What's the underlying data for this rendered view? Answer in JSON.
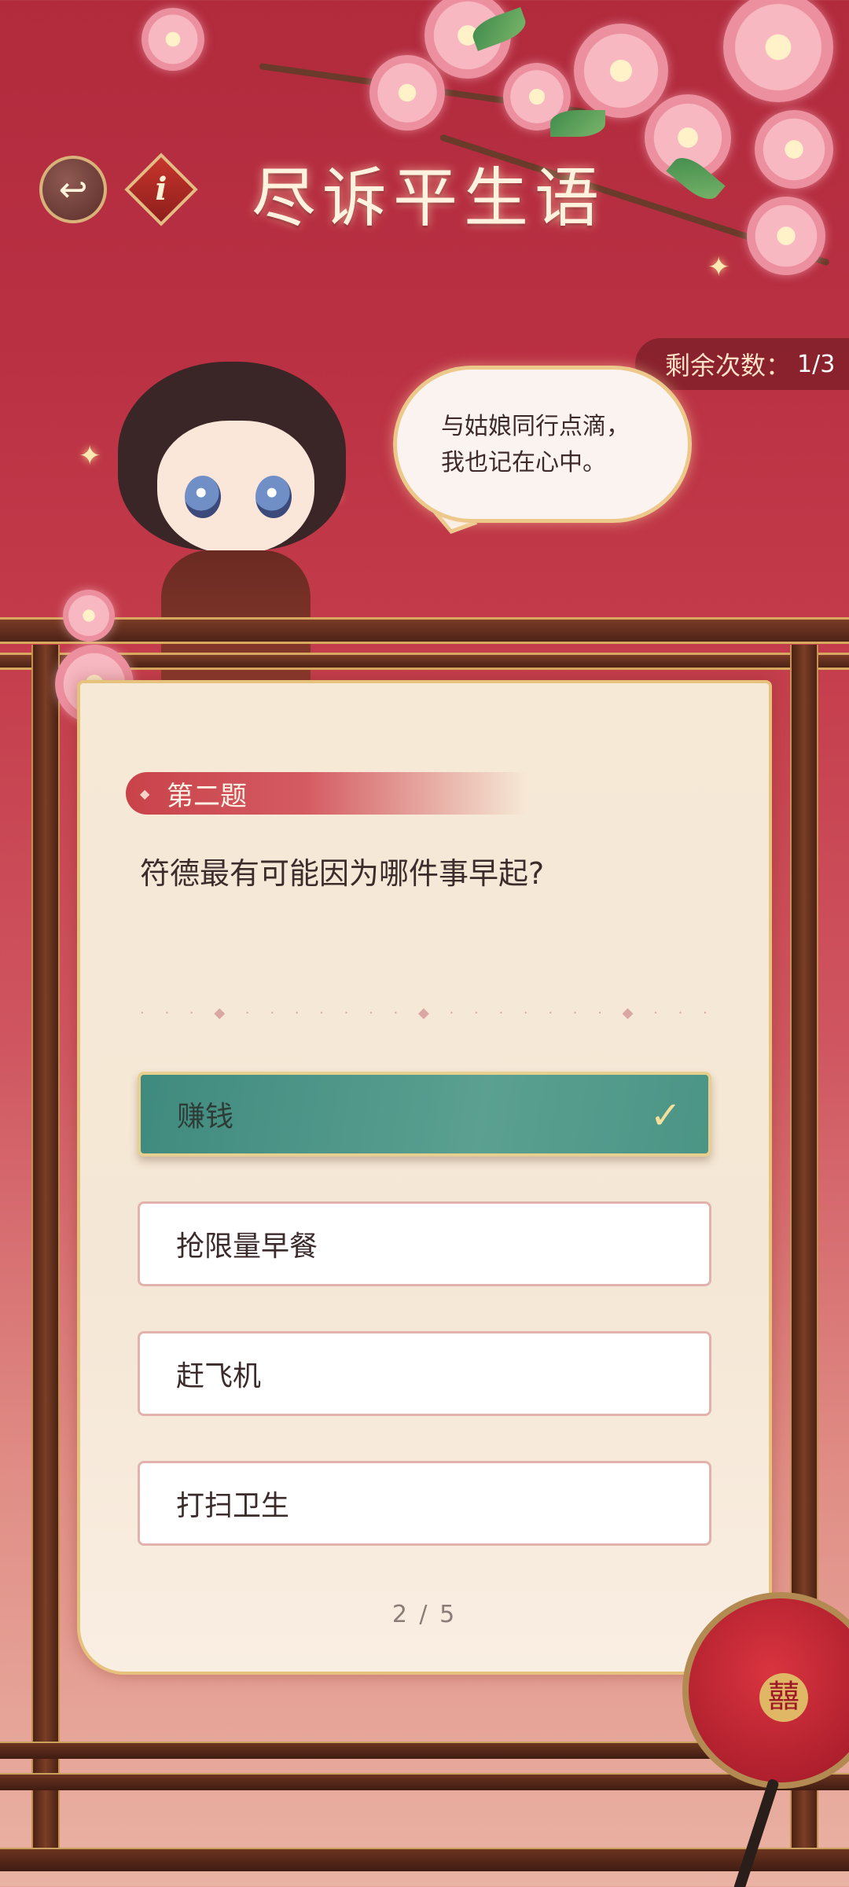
{
  "header": {
    "title": "尽诉平生语",
    "back_icon": "back-arrow-icon",
    "info_label": "i"
  },
  "remaining": {
    "label": "剩余次数：",
    "value": "1/3"
  },
  "speech": {
    "line1": "与姑娘同行点滴，",
    "line2": "我也记在心中。"
  },
  "question": {
    "tag": "第二题",
    "text": "符德最有可能因为哪件事早起?"
  },
  "options": [
    {
      "label": "赚钱",
      "selected": true
    },
    {
      "label": "抢限量早餐",
      "selected": false
    },
    {
      "label": "赶飞机",
      "selected": false
    },
    {
      "label": "打扫卫生",
      "selected": false
    }
  ],
  "pager": "2 / 5",
  "fan_emblem": "囍",
  "colors": {
    "background": "#b93043",
    "selected_option": "#4b9586",
    "card": "#f5e7d5",
    "accent_gold": "#e6c27d"
  }
}
